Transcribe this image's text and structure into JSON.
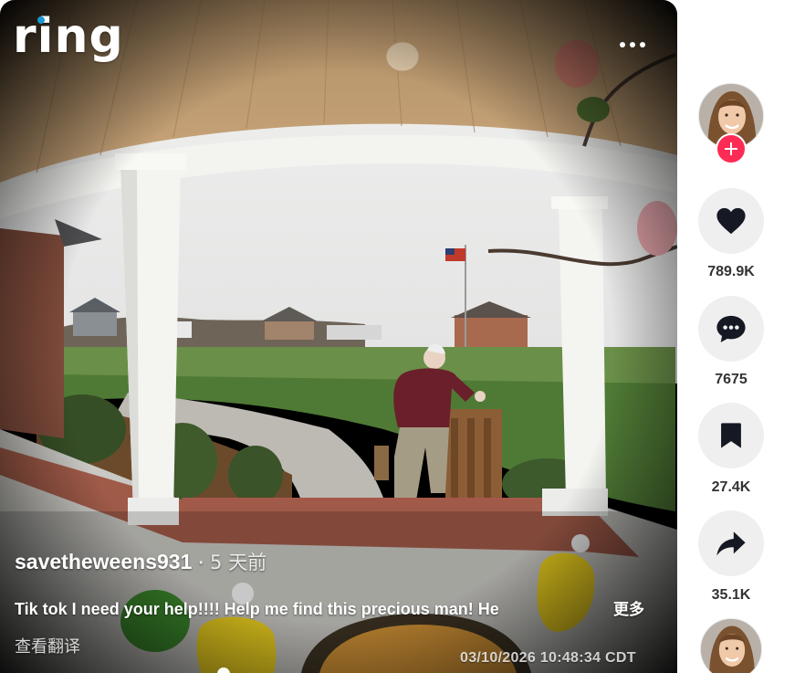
{
  "video": {
    "logo_text": "ring",
    "author": "savetheweens931",
    "separator": "·",
    "time_ago": "5 天前",
    "caption": "Tik tok I need your help!!!! Help me find this precious man! He",
    "more_label": "更多",
    "translate_label": "查看翻译",
    "timestamp": "03/10/2026 10:48:34 CDT"
  },
  "actions": {
    "likes": "789.9K",
    "comments": "7675",
    "saves": "27.4K",
    "shares": "35.1K"
  },
  "colors": {
    "follow_accent": "#fe2c55",
    "ring_dot": "#1998d5",
    "action_bg": "#efefef",
    "count_text": "#333333"
  },
  "icons": [
    "more-icon",
    "plus-icon",
    "heart-icon",
    "comment-icon",
    "bookmark-icon",
    "share-icon"
  ]
}
